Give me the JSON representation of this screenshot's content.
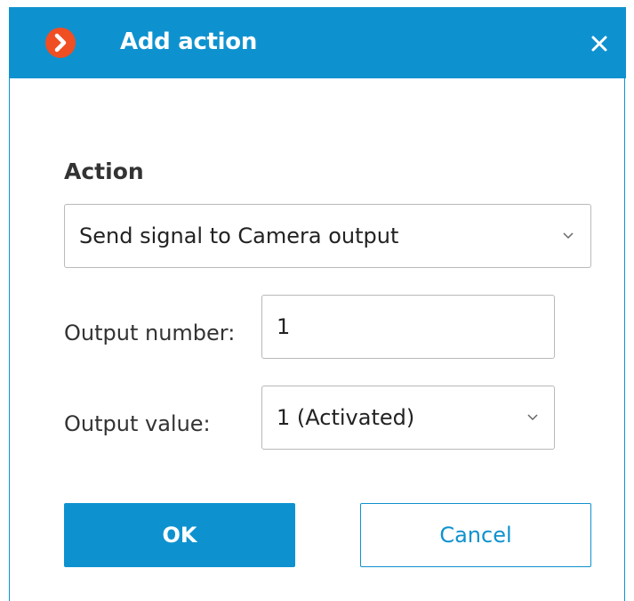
{
  "window": {
    "title": "Add action",
    "app_icon": "macroscop-chevron-logo-icon",
    "close_icon": "close-icon"
  },
  "form": {
    "section_label": "Action",
    "action_select": {
      "value": "Send signal to Camera output",
      "icon": "chevron-down-icon"
    },
    "output_number": {
      "label": "Output number:",
      "value": "1"
    },
    "output_value": {
      "label": "Output value:",
      "value": "1 (Activated)",
      "icon": "chevron-down-icon"
    }
  },
  "buttons": {
    "ok_label": "OK",
    "cancel_label": "Cancel"
  },
  "colors": {
    "accent": "#0e92cf",
    "logo": "#f04e23",
    "field_border": "#b9b9b9",
    "text": "#333333"
  }
}
